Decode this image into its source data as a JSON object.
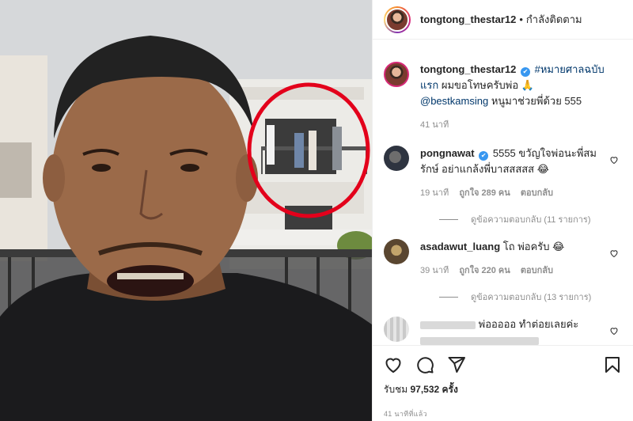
{
  "header": {
    "username": "tongtong_thestar12",
    "separator": "•",
    "follow_status": "กำลังติดตาม"
  },
  "caption": {
    "username": "tongtong_thestar12",
    "hashtag": "#หมายศาลฉบับแรก",
    "text": "ผมขอโทษครับพ่อ 🙏",
    "mention": "@bestkamsing",
    "text2": "หนูมาช่วยพี่ด้วย 555",
    "time": "41 นาที"
  },
  "comments": [
    {
      "username": "pongnawat",
      "verified": true,
      "text": "5555 ขวัญใจพ่อนะพี่สมรักษ์ อย่าแกล้งพี่บาสสสสส 😂",
      "time": "19 นาที",
      "likes": "ถูกใจ 289 คน",
      "reply": "ตอบกลับ",
      "view_replies": "ดูข้อความตอบกลับ (11 รายการ)"
    },
    {
      "username": "asadawut_luang",
      "verified": false,
      "text": "โถ พ่อครับ 😂",
      "time": "39 นาที",
      "likes": "ถูกใจ 220 คน",
      "reply": "ตอบกลับ",
      "view_replies": "ดูข้อความตอบกลับ (13 รายการ)"
    },
    {
      "username": "",
      "verified": false,
      "text": "พ่อออออ ทำต่อยเลยค่ะ",
      "time": "",
      "likes": "",
      "reply": "",
      "view_replies": ""
    }
  ],
  "footer": {
    "views_label": "รับชม",
    "views_count": "97,532",
    "views_suffix": "ครั้ง",
    "posted": "41 นาทีที่แล้ว"
  },
  "icons": {
    "like": "heart-icon",
    "comment": "comment-icon",
    "share": "paper-plane-icon",
    "save": "bookmark-icon"
  },
  "colors": {
    "verified": "#3897f0",
    "circle_annotation": "#e3001b",
    "muted": "#8e8e8e",
    "link": "#00376b"
  }
}
